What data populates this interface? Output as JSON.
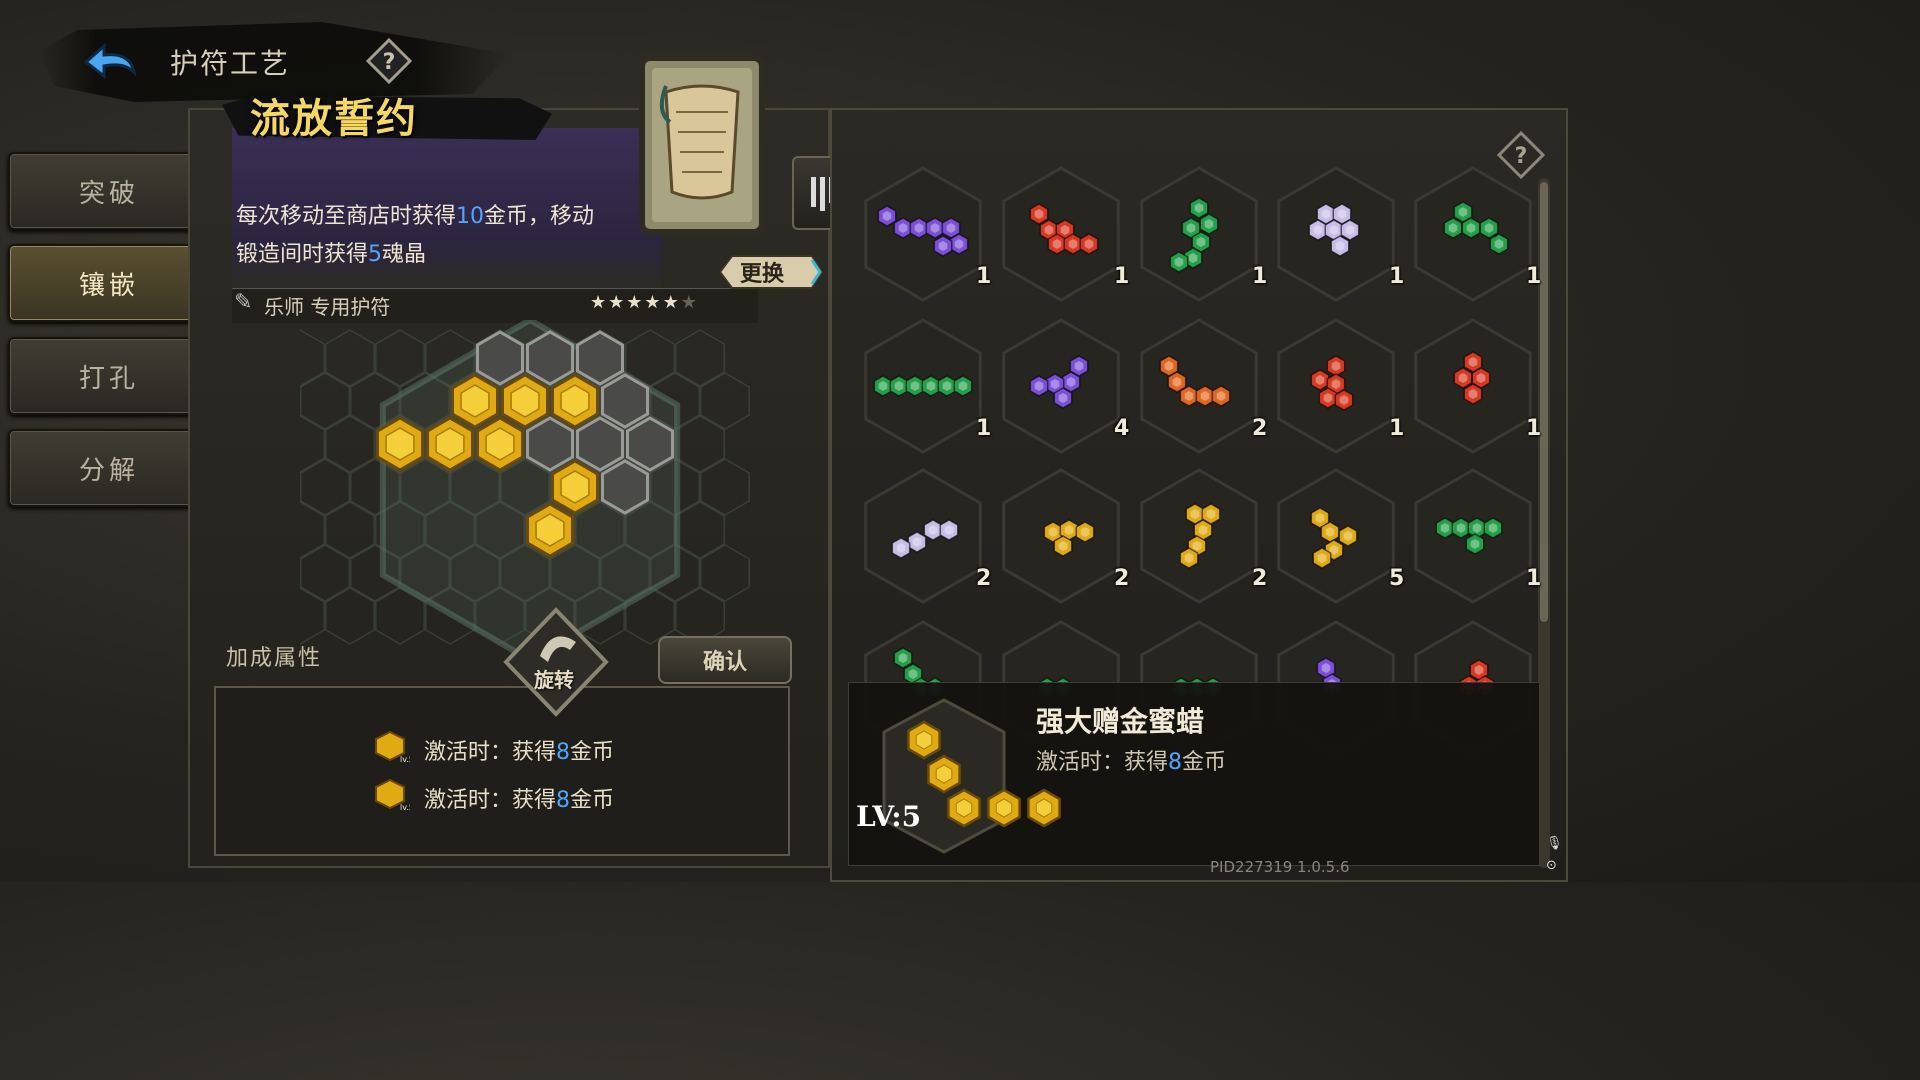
{
  "header": {
    "title": "护符工艺"
  },
  "side_menu": [
    {
      "label": "突破",
      "active": false
    },
    {
      "label": "镶嵌",
      "active": true
    },
    {
      "label": "打孔",
      "active": false
    },
    {
      "label": "分解",
      "active": false
    }
  ],
  "amulet": {
    "name": "流放誓约",
    "desc_parts": [
      "每次移动至商店时获得",
      "10",
      "金币，移动",
      "锻造间时获得",
      "5",
      "魂晶"
    ],
    "class_label": "乐师 专用护符",
    "stars_filled": 5,
    "stars_total": 6,
    "swap_label": "更换"
  },
  "bonus": {
    "title": "加成属性",
    "entries": [
      {
        "prefix": "激活时：获得",
        "value": "8",
        "suffix": "金币",
        "level": "lv.5"
      },
      {
        "prefix": "激活时：获得",
        "value": "8",
        "suffix": "金币",
        "level": "lv.5"
      }
    ]
  },
  "actions": {
    "rotate_label": "旋转",
    "confirm_label": "确认"
  },
  "gem_grid": [
    [
      {
        "color": "purple",
        "count": "1"
      },
      {
        "color": "red",
        "count": "1"
      },
      {
        "color": "green",
        "count": "1"
      },
      {
        "color": "lavender",
        "count": "1"
      },
      {
        "color": "green",
        "count": "1"
      }
    ],
    [
      {
        "color": "green",
        "count": "1"
      },
      {
        "color": "purple",
        "count": "4"
      },
      {
        "color": "orange",
        "count": "2"
      },
      {
        "color": "red",
        "count": "1"
      },
      {
        "color": "red",
        "count": "1"
      }
    ],
    [
      {
        "color": "lavender",
        "count": "2"
      },
      {
        "color": "gold",
        "count": "2"
      },
      {
        "color": "gold",
        "count": "2"
      },
      {
        "color": "gold",
        "count": "5"
      },
      {
        "color": "green",
        "count": "1"
      }
    ],
    [
      {
        "color": "green",
        "count": ""
      },
      {
        "color": "green",
        "count": ""
      },
      {
        "color": "green",
        "count": ""
      },
      {
        "color": "purple",
        "count": ""
      },
      {
        "color": "red",
        "count": ""
      }
    ]
  ],
  "colors": {
    "purple": "#7b4fd6",
    "red": "#d63a22",
    "green": "#25a04a",
    "lavender": "#c7bde6",
    "gold": "#e0aa12",
    "orange": "#e0661e"
  },
  "tooltip": {
    "name": "强大赠金蜜蜡",
    "desc_prefix": "激活时：获得",
    "desc_value": "8",
    "desc_suffix": "金币",
    "level": "LV:5"
  },
  "footer": {
    "pid": "PID227319 1.0.5.6"
  }
}
